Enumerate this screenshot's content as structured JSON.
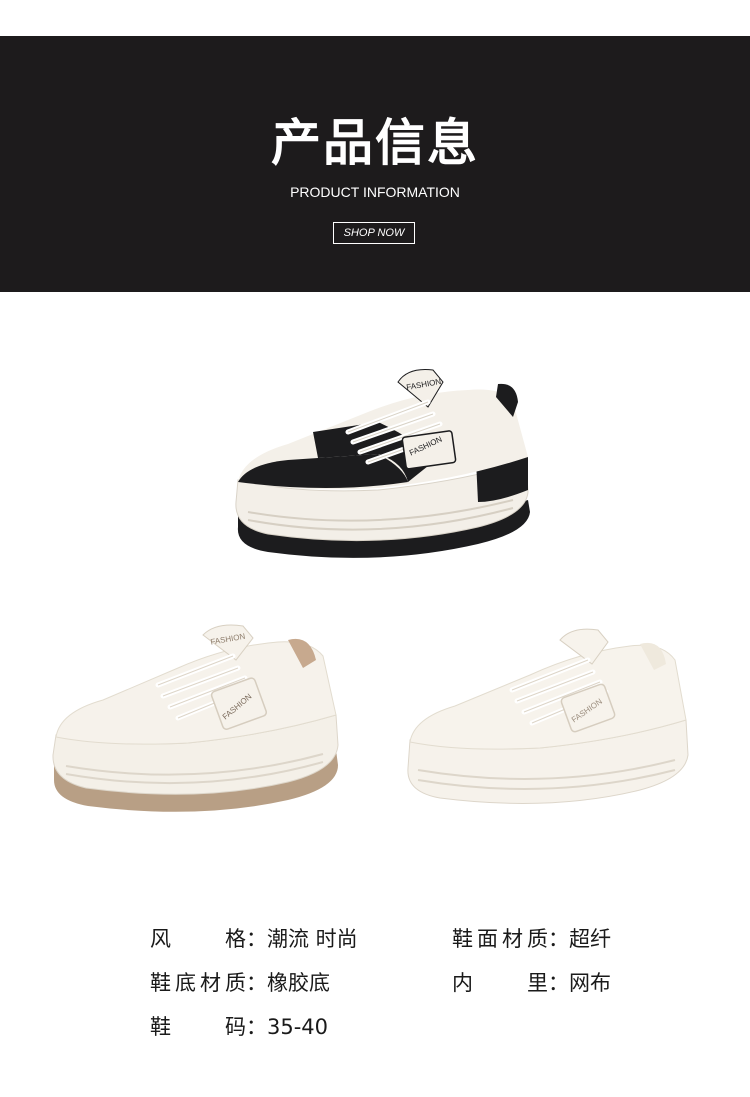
{
  "banner": {
    "title": "产品信息",
    "subtitle": "PRODUCT INFORMATION",
    "button_label": "SHOP NOW",
    "bg_color": "#1d1b1c"
  },
  "products": [
    {
      "name": "black-white-sneaker",
      "tag_text": "FASHION",
      "accent_color": "#1c1c1e"
    },
    {
      "name": "khaki-white-sneaker",
      "tag_text": "FASHION",
      "accent_color": "#b89f85"
    },
    {
      "name": "cream-white-sneaker",
      "tag_text": "FASHION",
      "accent_color": "#efe9dd"
    }
  ],
  "specs": [
    {
      "label": "风格",
      "value": "潮流 时尚"
    },
    {
      "label": "鞋面材质",
      "value": "超纤"
    },
    {
      "label": "鞋底材质",
      "value": "橡胶底"
    },
    {
      "label": "内里",
      "value": "网布"
    },
    {
      "label": "鞋码",
      "value": "35-40"
    }
  ],
  "colon": "："
}
